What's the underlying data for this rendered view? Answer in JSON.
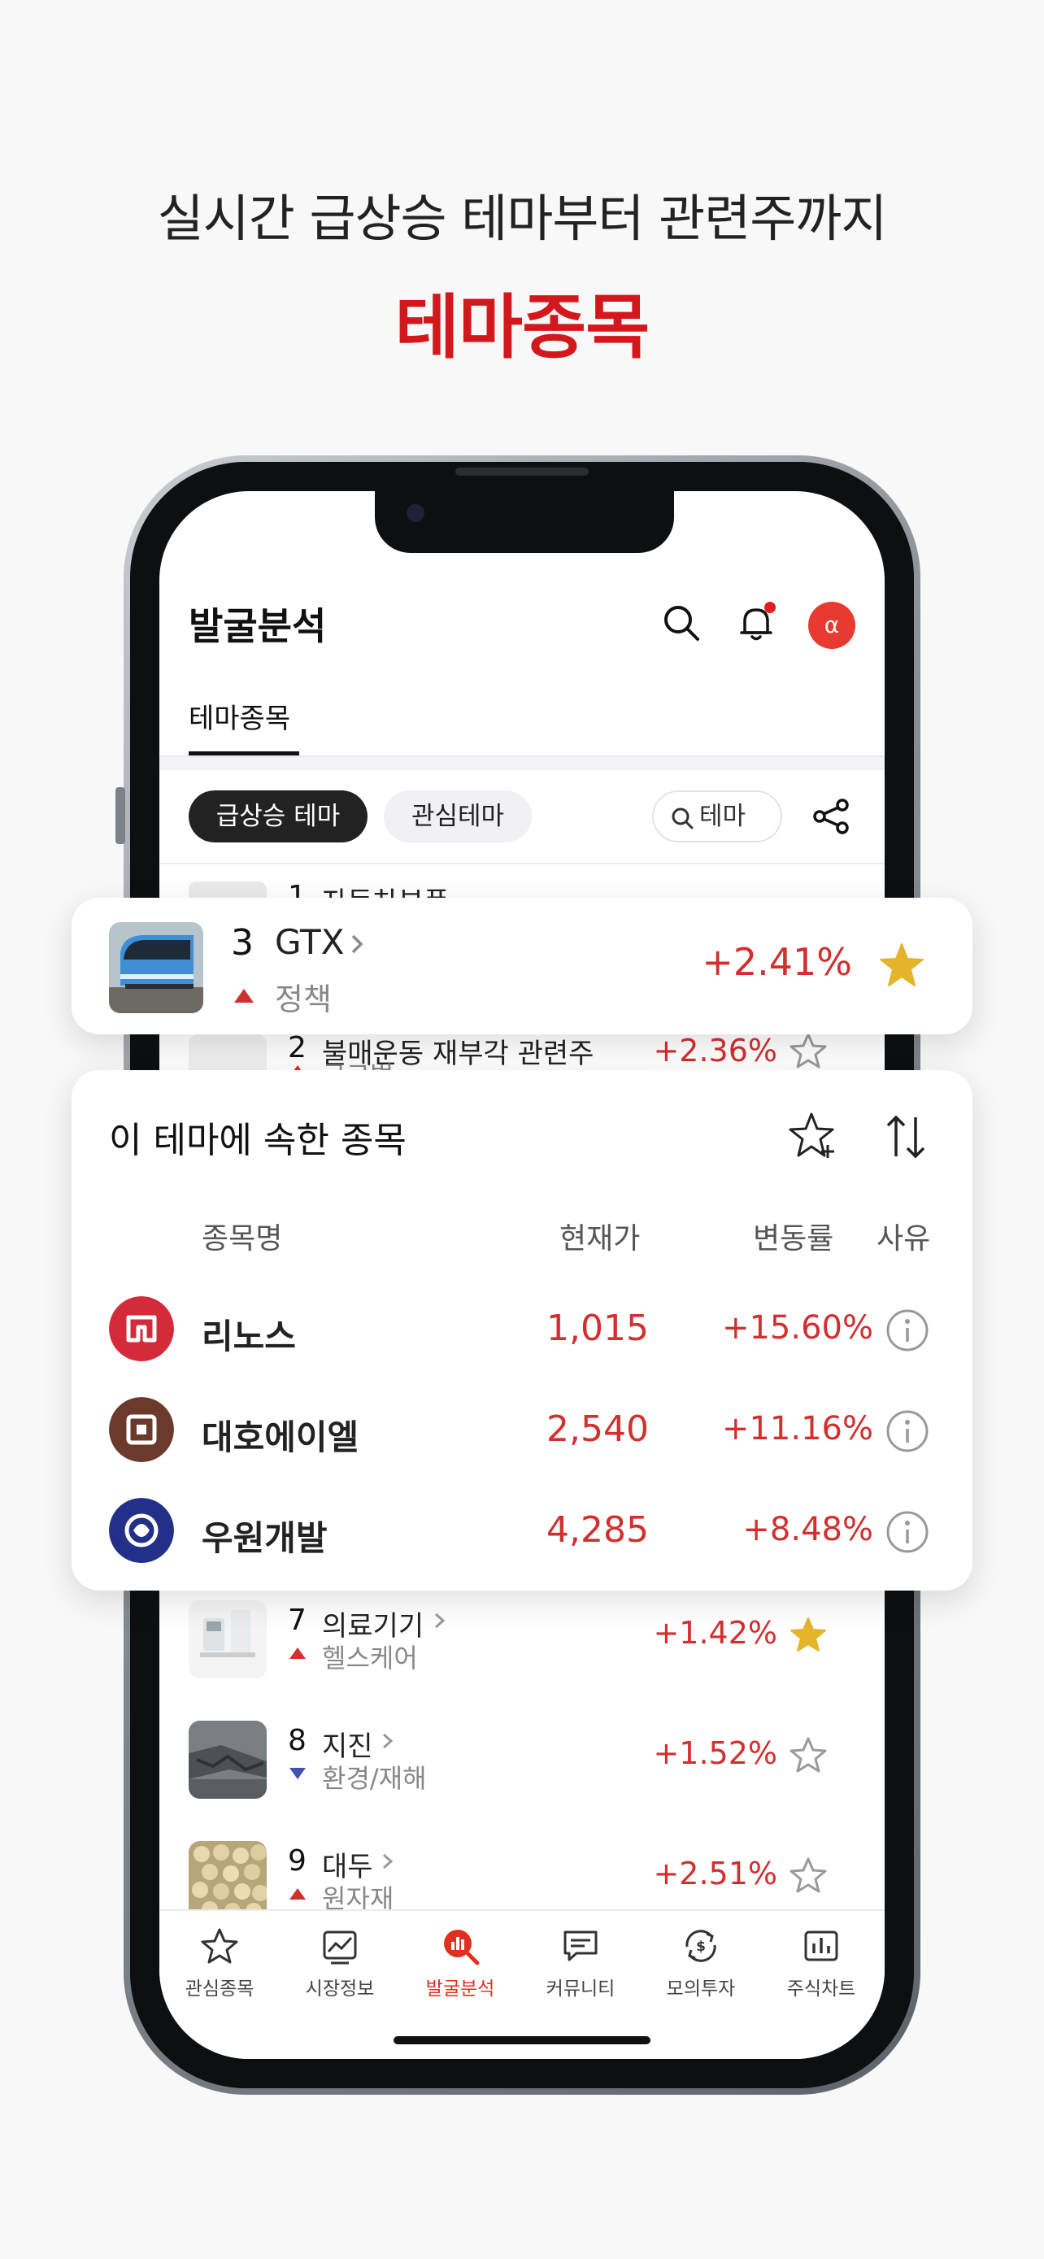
{
  "headline": "실시간 급상승 테마부터 관련주까지",
  "headline_sub": "테마종목",
  "app": {
    "title": "발굴분석",
    "tab": "테마종목",
    "avatar_glyph": "α"
  },
  "chips": {
    "hot": "급상승 테마",
    "fav": "관심테마",
    "search": "테마"
  },
  "peek_rows": [
    {
      "rank": "1",
      "name": "자동차부품"
    },
    {
      "rank": "2",
      "name": "불매운동 재부각 관련주",
      "category": "글로벌",
      "rate": "+2.36%"
    }
  ],
  "highlight": {
    "rank": "3",
    "name": "GTX",
    "category": "정책",
    "rate": "+2.41%",
    "starred": true
  },
  "stock_card": {
    "title": "이 테마에 속한 종목",
    "headers": {
      "name": "종목명",
      "price": "현재가",
      "rate": "변동률",
      "reason": "사유"
    },
    "stocks": [
      {
        "name": "리노스",
        "price": "1,015",
        "rate": "+15.60%",
        "logo_color": "#d42b3a"
      },
      {
        "name": "대호에이엘",
        "price": "2,540",
        "rate": "+11.16%",
        "logo_color": "#6b3a2c"
      },
      {
        "name": "우원개발",
        "price": "4,285",
        "rate": "+8.48%",
        "logo_color": "#22308a"
      }
    ]
  },
  "rows": [
    {
      "rank": "7",
      "name": "의료기기",
      "category": "헬스케어",
      "rate": "+1.42%",
      "trend": "up",
      "starred": true
    },
    {
      "rank": "8",
      "name": "지진",
      "category": "환경/재해",
      "rate": "+1.52%",
      "trend": "down",
      "starred": false
    },
    {
      "rank": "9",
      "name": "대두",
      "category": "원자재",
      "rate": "+2.51%",
      "trend": "up",
      "starred": false
    }
  ],
  "nav": [
    {
      "label": "관심종목",
      "icon": "star-icon"
    },
    {
      "label": "시장정보",
      "icon": "chart-line-icon"
    },
    {
      "label": "발굴분석",
      "icon": "discover-icon",
      "active": true
    },
    {
      "label": "커뮤니티",
      "icon": "chat-icon"
    },
    {
      "label": "모의투자",
      "icon": "invest-icon"
    },
    {
      "label": "주식차트",
      "icon": "bar-chart-icon"
    }
  ],
  "colors": {
    "accent": "#d3181d",
    "rise": "#d32f2f",
    "fall": "#3f51b5",
    "star_fill": "#e5b42b"
  }
}
